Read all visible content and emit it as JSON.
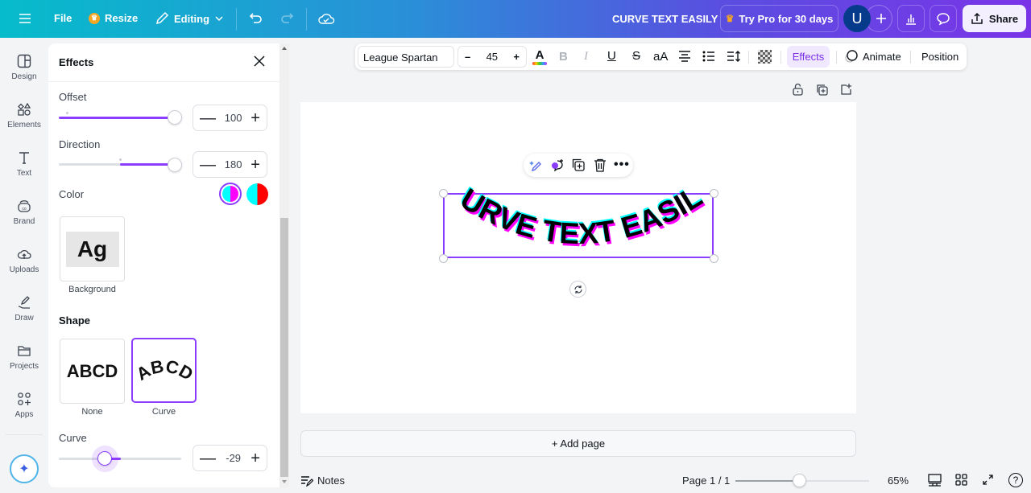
{
  "topbar": {
    "file_label": "File",
    "resize_label": "Resize",
    "editing_label": "Editing",
    "doc_title": "CURVE TEXT EASILY",
    "try_pro_label": "Try Pro for 30 days",
    "avatar_initial": "U",
    "share_label": "Share",
    "colors": {
      "pro_crown": "#f5a623",
      "avatar_bg": "#063b8c"
    }
  },
  "rail": {
    "items": [
      {
        "label": "Design",
        "icon": "layout-icon"
      },
      {
        "label": "Elements",
        "icon": "shapes-icon"
      },
      {
        "label": "Text",
        "icon": "text-icon"
      },
      {
        "label": "Brand",
        "icon": "brand-icon"
      },
      {
        "label": "Uploads",
        "icon": "cloud-upload-icon"
      },
      {
        "label": "Draw",
        "icon": "pen-icon"
      },
      {
        "label": "Projects",
        "icon": "folder-icon"
      },
      {
        "label": "Apps",
        "icon": "apps-icon"
      }
    ]
  },
  "panel": {
    "title": "Effects",
    "offset": {
      "label": "Offset",
      "value": "100",
      "fraction": 1.0
    },
    "direction": {
      "label": "Direction",
      "value": "180",
      "fraction": 1.0
    },
    "color": {
      "label": "Color",
      "swatch1": [
        "#00ffff",
        "#ff00ff"
      ],
      "swatch2": [
        "#00ffff",
        "#ff0000"
      ]
    },
    "background_tile_text": "Ag",
    "background_label": "Background",
    "shape_heading": "Shape",
    "shapes": [
      {
        "label": "None",
        "preview": "ABCD",
        "selected": false
      },
      {
        "label": "Curve",
        "preview": "ABCD",
        "selected": true
      }
    ],
    "curve": {
      "label": "Curve",
      "value": "-29",
      "min": -100,
      "max": 100
    }
  },
  "toolbar": {
    "font": "League Spartan",
    "font_size": "45",
    "minus": "–",
    "plus": "+",
    "case_label": "aA",
    "effects_label": "Effects",
    "animate_label": "Animate",
    "position_label": "Position"
  },
  "canvas": {
    "text": "CURVE TEXT EASILY",
    "text_color": "#000000",
    "shadow_colors": [
      "#00ffff",
      "#ff00ff"
    ],
    "selection_color": "#8b3dff"
  },
  "footer": {
    "add_page": "+ Add page",
    "notes": "Notes",
    "page": "Page 1 / 1",
    "zoom": "65%",
    "zoom_fraction": 0.47
  },
  "accent": "#8b3dff"
}
